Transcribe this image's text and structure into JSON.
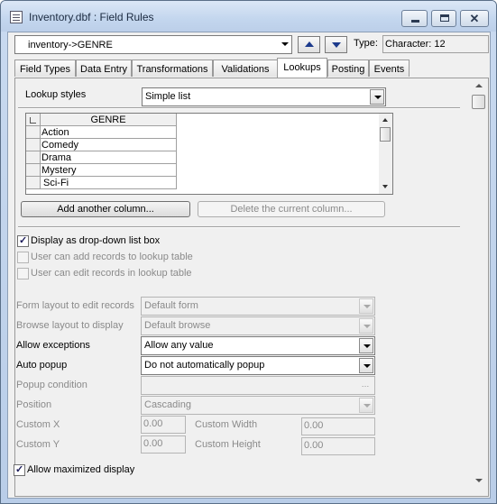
{
  "window": {
    "title": "Inventory.dbf : Field Rules",
    "icon": "table-icon"
  },
  "field_selector": {
    "value": "inventory->GENRE",
    "type_label": "Type:",
    "type_value": "Character: 12"
  },
  "tabs": [
    {
      "label": "Field Types"
    },
    {
      "label": "Data Entry"
    },
    {
      "label": "Transformations"
    },
    {
      "label": "Validations"
    },
    {
      "label": "Lookups",
      "active": true
    },
    {
      "label": "Posting"
    },
    {
      "label": "Events"
    }
  ],
  "lookups": {
    "styles_label": "Lookup styles",
    "styles_value": "Simple list",
    "grid": {
      "column_header": "GENRE",
      "rows": [
        "Action",
        "Comedy",
        "Drama",
        "Mystery",
        "Sci-Fi"
      ]
    },
    "add_column_button": "Add another column...",
    "delete_column_button": "Delete the current column...",
    "display_dropdown": {
      "label": "Display as drop-down list box",
      "checked": true
    },
    "user_can_add": {
      "label": "User can add records to lookup table",
      "checked": false
    },
    "user_can_edit": {
      "label": "User can edit records in lookup table",
      "checked": false
    },
    "form_layout": {
      "label": "Form layout to edit records",
      "value": "Default form"
    },
    "browse_layout": {
      "label": "Browse layout to display",
      "value": "Default browse"
    },
    "allow_exceptions": {
      "label": "Allow exceptions",
      "value": "Allow any value"
    },
    "auto_popup": {
      "label": "Auto popup",
      "value": "Do not automatically popup"
    },
    "popup_condition": {
      "label": "Popup condition",
      "value": ""
    },
    "position": {
      "label": "Position",
      "value": "Cascading"
    },
    "custom_x": {
      "label": "Custom X",
      "value": "0.00"
    },
    "custom_y": {
      "label": "Custom Y",
      "value": "0.00"
    },
    "custom_width": {
      "label": "Custom Width",
      "value": "0.00"
    },
    "custom_height": {
      "label": "Custom Height",
      "value": "0.00"
    },
    "allow_maximized": {
      "label": "Allow maximized display",
      "checked": true
    }
  }
}
